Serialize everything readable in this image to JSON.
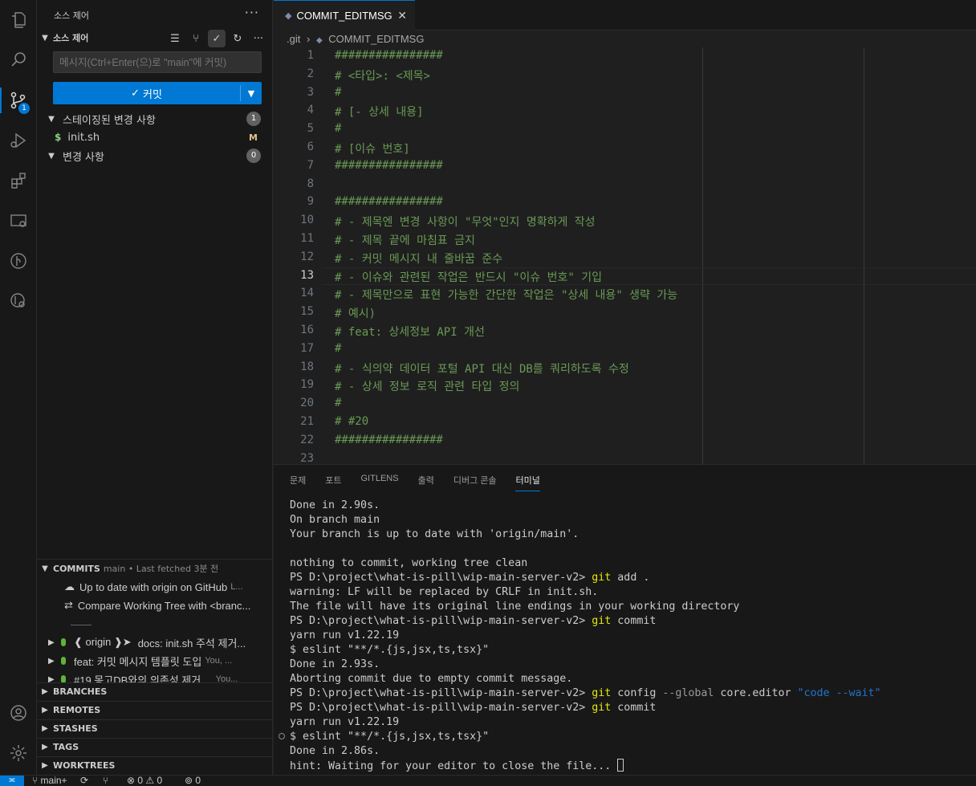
{
  "activity": {
    "scm_badge": "1"
  },
  "sidebar": {
    "title": "소스 제어",
    "more": "···",
    "scm_section": "소스 제어",
    "message_placeholder": "메시지(Ctrl+Enter(으)로 \"main\"에 커밋)",
    "commit_label": "커밋",
    "staged": {
      "label": "스테이징된 변경 사항",
      "count": "1",
      "files": [
        {
          "name": "init.sh",
          "status": "M"
        }
      ]
    },
    "changes": {
      "label": "변경 사항",
      "count": "0"
    }
  },
  "gitlens": {
    "title": "COMMITS",
    "subtitle": "main • Last fetched 3분 전",
    "rows": {
      "up_to_date": "Up to date with origin on GitHub",
      "up_to_date_tail": "L...",
      "compare": "Compare Working Tree with <branc...",
      "divider": "——"
    },
    "commits": [
      {
        "tag": "❰ origin ❱➤",
        "message": "docs: init.sh 주석 제거...",
        "author": ""
      },
      {
        "tag": "",
        "message": "feat: 커밋 메시지 템플릿 도입",
        "author": "You, ..."
      },
      {
        "tag": "",
        "message": "#19 몽고DB와의 의존성 제거 ...",
        "author": "You..."
      }
    ],
    "sections": [
      "BRANCHES",
      "REMOTES",
      "STASHES",
      "TAGS",
      "WORKTREES"
    ]
  },
  "editor": {
    "tab": "COMMIT_EDITMSG",
    "breadcrumb": [
      ".git",
      "COMMIT_EDITMSG"
    ],
    "current_line": 13,
    "lines": [
      "################",
      "# <타입>: <제목>",
      "#",
      "# [- 상세 내용]",
      "#",
      "# [이슈 번호]",
      "################",
      "",
      "################",
      "# - 제목엔 변경 사항이 \"무엇\"인지 명확하게 작성",
      "# - 제목 끝에 마침표 금지",
      "# - 커밋 메시지 내 줄바꿈 준수",
      "# - 이슈와 관련된 작업은 반드시 \"이슈 번호\" 기입",
      "# - 제목만으로 표현 가능한 간단한 작업은 \"상세 내용\" 생략 가능",
      "# 예시)",
      "# feat: 상세정보 API 개선",
      "#",
      "# - 식의약 데이터 포털 API 대신 DB를 쿼리하도록 수정",
      "# - 상세 정보 로직 관련 타입 정의",
      "#",
      "# #20",
      "################",
      ""
    ]
  },
  "panel": {
    "tabs": [
      "문제",
      "포트",
      "GITLENS",
      "출력",
      "디버그 콘솔",
      "터미널"
    ],
    "active_tab": "터미널",
    "terminal": [
      {
        "t": "Done in 2.90s."
      },
      {
        "t": "On branch main"
      },
      {
        "t": "Your branch is up to date with 'origin/main'."
      },
      {
        "t": ""
      },
      {
        "t": "nothing to commit, working tree clean"
      },
      {
        "p": "PS D:\\project\\what-is-pill\\wip-main-server-v2> ",
        "c": "git",
        "r": " add ."
      },
      {
        "t": "warning: LF will be replaced by CRLF in init.sh."
      },
      {
        "t": "The file will have its original line endings in your working directory"
      },
      {
        "p": "PS D:\\project\\what-is-pill\\wip-main-server-v2> ",
        "c": "git",
        "r": " commit"
      },
      {
        "t": "yarn run v1.22.19"
      },
      {
        "t": "$ eslint \"**/*.{js,jsx,ts,tsx}\""
      },
      {
        "t": "Done in 2.93s."
      },
      {
        "t": "Aborting commit due to empty commit message."
      },
      {
        "p": "PS D:\\project\\what-is-pill\\wip-main-server-v2> ",
        "c": "git",
        "r": " config ",
        "d": "--global",
        "r2": " core.editor ",
        "a": "\"code --wait\""
      },
      {
        "p": "PS D:\\project\\what-is-pill\\wip-main-server-v2> ",
        "c": "git",
        "r": " commit"
      },
      {
        "t": "yarn run v1.22.19"
      },
      {
        "t": "$ eslint \"**/*.{js,jsx,ts,tsx}\""
      },
      {
        "t": "Done in 2.86s."
      },
      {
        "t": "hint: Waiting for your editor to close the file... ",
        "cursor": true
      }
    ]
  },
  "status": {
    "remote": "≍",
    "branch": "main+",
    "sync": "⟳",
    "errors": "0",
    "warnings": "0",
    "ports": "0"
  }
}
